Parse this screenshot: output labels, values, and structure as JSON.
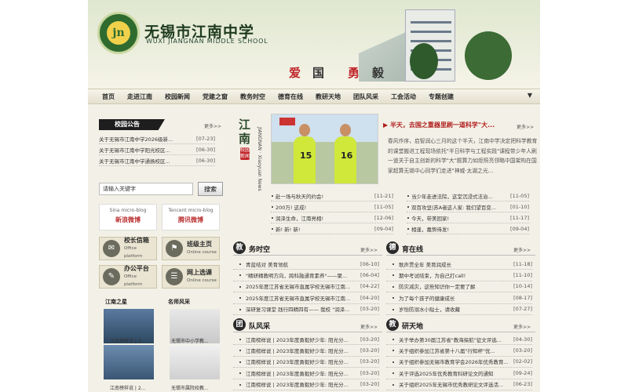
{
  "school": {
    "name": "无锡市江南中学",
    "name_en": "WUXI JIANGNAN MIDDLE SCHOOL",
    "logo_text": "jn",
    "motto": [
      "爱",
      "国",
      "勇",
      "毅"
    ]
  },
  "nav": [
    "首页",
    "走进江南",
    "校园新闻",
    "党建之窗",
    "教务时空",
    "德育在线",
    "教研天地",
    "团队风采",
    "工会活动",
    "专题创建"
  ],
  "notice": {
    "title": "校园公告",
    "more": "更多>>",
    "items": [
      {
        "t": "关于无锡市江南中学2026级新...",
        "d": "[07-23]"
      },
      {
        "t": "关于无锡市江南中学阳光校区...",
        "d": "[06-30]"
      },
      {
        "t": "关于无锡市江南中学通扬校区...",
        "d": "[06-30]"
      }
    ]
  },
  "search": {
    "placeholder": "请输入关键字",
    "button": "搜索"
  },
  "weibo": [
    {
      "name": "Sina micro-blog",
      "label": "新浪微博"
    },
    {
      "name": "Tencent micro-blog",
      "label": "腾讯微博"
    }
  ],
  "platforms": [
    {
      "label": "校长信箱",
      "sub": "Office platform"
    },
    {
      "label": "班级主页",
      "sub": "Online course"
    },
    {
      "label": "办公平台",
      "sub": "Office platform"
    },
    {
      "label": "网上选课",
      "sub": "Online course"
    }
  ],
  "stars": {
    "student_title": "江南之星",
    "teacher_title": "名师风采",
    "captions": [
      "江南榜样说 | 2...",
      "无锡市中小学教...",
      "江南榜样说 | 2...",
      "无锡市属院校教..."
    ]
  },
  "campus": {
    "title_chars": [
      "江",
      "南"
    ],
    "badge": "校园新闻",
    "sub": "JIANGNAN · Xiaoyuan News",
    "more": "更多>>",
    "headline": "▶ 半天，去国之重器里刷一道科学\"大...",
    "summary": "春风作序，启智润心三月的这个半天，江南中学决定把科学教育的课堂搬进工程现场依托\"半日科学与工程实践\"课程带少年人刷一道关于自主创新的科学\"大\"题算力如炬照亮领略中国架构在国家超算无锡中心同学们走进\"神威·太湖之光...",
    "left": [
      {
        "t": "赴一场与秋天的约会!",
        "d": "[11-21]"
      },
      {
        "t": "200万! 这成!",
        "d": "[11-05]"
      },
      {
        "t": "润泽生命，江南亮相!",
        "d": "[12-06]"
      },
      {
        "t": "新! 新! 新!",
        "d": "[09-04]"
      }
    ],
    "right": [
      {
        "t": "当少年走进法院，这堂沉浸式法治...",
        "d": "[11-05]"
      },
      {
        "t": "双百攻坚|苏A者这人家: 我们望百变...",
        "d": "[01-10]"
      },
      {
        "t": "今天，带美回家!",
        "d": "[11-17]"
      },
      {
        "t": "相逢，嘉势待发!",
        "d": "[09-04]"
      }
    ]
  },
  "sections": [
    {
      "badge": "教",
      "title": "务时空",
      "more": "更多>>",
      "items": [
        {
          "t": "青蓝结对 美育领航",
          "d": "[06-10]"
        },
        {
          "t": "\"精研精教明方向，跨科融通育素养\"——聚...",
          "d": "[06-04]"
        },
        {
          "t": "2025年度江苏省无锡市直属学校无锡市江南...",
          "d": "[04-22]"
        },
        {
          "t": "2025年度江苏省无锡市直属学校无锡市江南...",
          "d": "[04-20]"
        },
        {
          "t": "深研复习课堂 践行四精四有—— 我校 \"润泽...",
          "d": "[03-20]"
        }
      ]
    },
    {
      "badge": "德",
      "title": "育在线",
      "more": "更多>>",
      "items": [
        {
          "t": "歌声贯全年 美育润成长",
          "d": "[11-18]"
        },
        {
          "t": "期中考试结束，为自己打call!",
          "d": "[11-10]"
        },
        {
          "t": "防灾减灾，这些知识你一定要了解",
          "d": "[10-14]"
        },
        {
          "t": "为了每个孩子的健康成长",
          "d": "[08-17]"
        },
        {
          "t": "岁怡防溺水小贴士，请收藏",
          "d": "[07-27]"
        }
      ]
    },
    {
      "badge": "团",
      "title": "队风采",
      "more": "更多>>",
      "items": [
        {
          "t": "江南榜样说 | 2023年度勇毅好少年: 阳光分...",
          "d": "[03-20]"
        },
        {
          "t": "江南榜样说 | 2023年度勇毅好少年: 阳光分...",
          "d": "[03-20]"
        },
        {
          "t": "江南榜样说 | 2023年度勇毅好少年: 阳光分...",
          "d": "[03-20]"
        },
        {
          "t": "江南榜样说 | 2023年度勇毅好少年: 阳光分...",
          "d": "[03-20]"
        },
        {
          "t": "江南榜样说 | 2023年度勇毅好少年: 阳光分...",
          "d": "[03-20]"
        },
        {
          "t": "江南榜样说 | 2023年度勇毅好少年: 阳光分...",
          "d": "[03-20]"
        }
      ]
    },
    {
      "badge": "教",
      "title": "研天地",
      "more": "更多>>",
      "items": [
        {
          "t": "关于举办第30届江苏省\"教海探航\"征文评选...",
          "d": "[04-30]"
        },
        {
          "t": "关于组织参加江苏省第十八届\"行知杯\"优...",
          "d": "[03-20]"
        },
        {
          "t": "关于组织参加无锡市教育学会2026年优秀教育...",
          "d": "[02-02]"
        },
        {
          "t": "关于评选2025年优秀教育科研论文的通知",
          "d": "[09-24]"
        },
        {
          "t": "关于组织2025年无锡市优秀教研论文评选活...",
          "d": "[06-23]"
        }
      ]
    }
  ]
}
